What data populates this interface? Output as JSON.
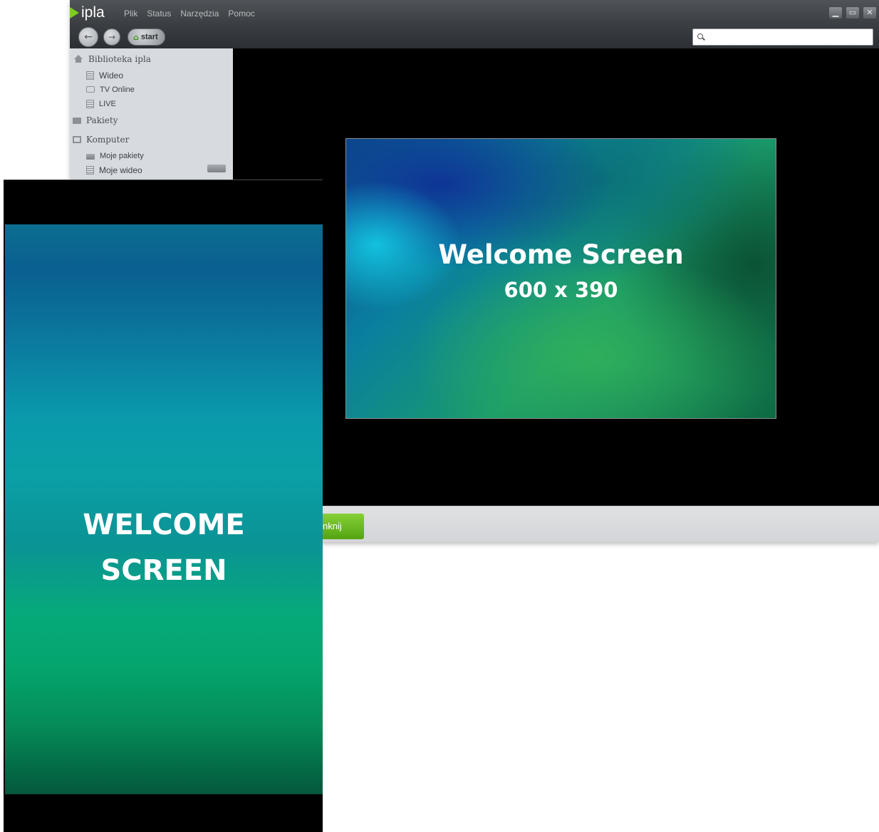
{
  "app": {
    "logo_text": "ipla",
    "menu": [
      "Plik",
      "Status",
      "Narzędzia",
      "Pomoc"
    ],
    "nav": {
      "back_icon": "back-arrow-icon",
      "forward_icon": "forward-arrow-icon",
      "start_label": "start"
    },
    "search": {
      "value": "",
      "placeholder": ""
    },
    "window_controls": [
      "minimize-icon",
      "maximize-icon",
      "close-icon"
    ],
    "sidebar": {
      "items": [
        {
          "label": "Biblioteka ipla",
          "icon": "home-icon",
          "level": 0
        },
        {
          "label": "Wideo",
          "icon": "film-icon",
          "level": 1
        },
        {
          "label": "TV Online",
          "icon": "tv-icon",
          "level": 1
        },
        {
          "label": "LIVE",
          "icon": "film-icon",
          "level": 1
        },
        {
          "label": "Pakiety",
          "icon": "folder-icon",
          "level": 0
        },
        {
          "label": "Komputer",
          "icon": "monitor-icon",
          "level": 0
        },
        {
          "label": "Moje pakiety",
          "icon": "drive-icon",
          "level": 1
        },
        {
          "label": "Moje wideo",
          "icon": "film-icon",
          "level": 1
        }
      ]
    },
    "welcome_landscape": {
      "title": "Welcome Screen",
      "size": "600 x 390"
    },
    "bottom_button_label": "nknij",
    "colors": {
      "accent_green": "#6cbd25",
      "titlebar": "#3b3e42",
      "sidebar_bg": "#d7dade"
    }
  },
  "mobile": {
    "title_line1": "WELCOME",
    "title_line2": "SCREEN"
  }
}
